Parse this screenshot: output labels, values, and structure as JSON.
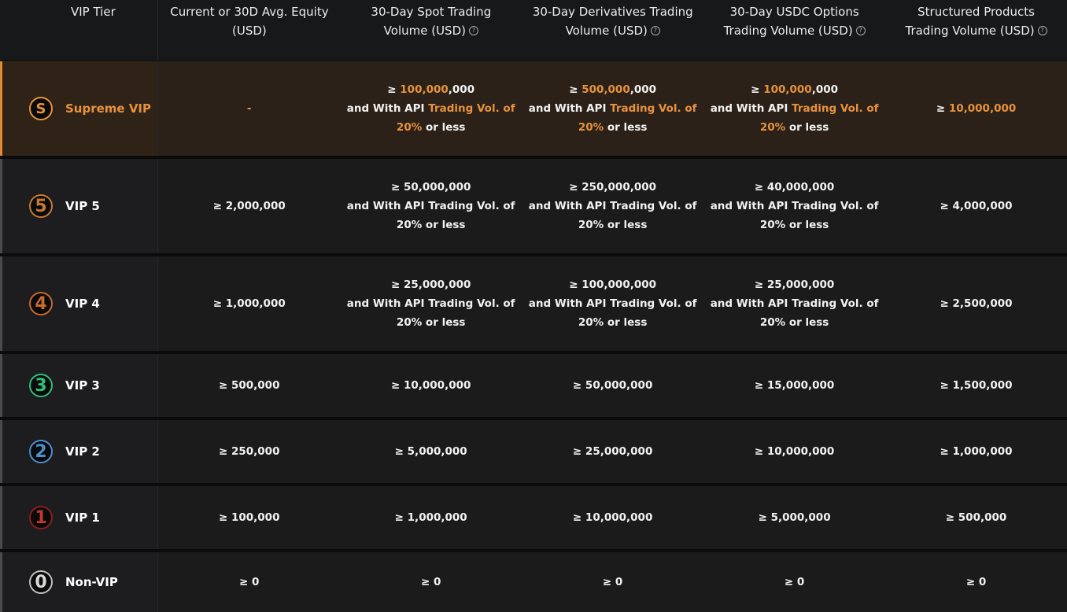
{
  "header": {
    "tier": "VIP Tier",
    "equity": [
      "Current or 30D Avg. Equity",
      "(USD)"
    ],
    "spot": [
      "30-Day Spot Trading",
      "Volume (USD)"
    ],
    "derivatives": [
      "30-Day Derivatives Trading",
      "Volume (USD)"
    ],
    "options": [
      "30-Day USDC Options",
      "Trading Volume (USD)"
    ],
    "structured": [
      "Structured Products",
      "Trading Volume (USD)"
    ],
    "help_icon": "question-circle-icon"
  },
  "supreme": {
    "badge": "S",
    "name_prefix": "Supreme",
    "name_suffix": " VIP",
    "equity": "-",
    "spot_ge": "≥ ",
    "spot_highlight": "100,000",
    "spot_rest": ",000",
    "deriv_ge": "≥ ",
    "deriv_highlight": "500,000",
    "deriv_rest": ",000",
    "options_ge": "≥ ",
    "options_highlight": "100,000",
    "options_rest": ",000",
    "api_prefix": "and With API ",
    "api_highlight": "Trading Vol. of",
    "api_pct": "20%",
    "api_suffix": " or less",
    "structured_ge": "≥ ",
    "structured_highlight": "10,000,000"
  },
  "api_line1": "and With API Trading Vol. of",
  "api_line2": "20% or less",
  "tiers": [
    {
      "badge": "5",
      "name": "VIP 5",
      "equity": "≥ 2,000,000",
      "spot": "≥ 50,000,000",
      "deriv": "≥ 250,000,000",
      "options": "≥ 40,000,000",
      "structured": "≥ 4,000,000"
    },
    {
      "badge": "4",
      "name": "VIP 4",
      "equity": "≥ 1,000,000",
      "spot": "≥ 25,000,000",
      "deriv": "≥ 100,000,000",
      "options": "≥ 25,000,000",
      "structured": "≥ 2,500,000"
    },
    {
      "badge": "3",
      "name": "VIP 3",
      "equity": "≥ 500,000",
      "spot": "≥ 10,000,000",
      "deriv": "≥ 50,000,000",
      "options": "≥ 15,000,000",
      "structured": "≥ 1,500,000"
    },
    {
      "badge": "2",
      "name": "VIP 2",
      "equity": "≥ 250,000",
      "spot": "≥ 5,000,000",
      "deriv": "≥ 25,000,000",
      "options": "≥ 10,000,000",
      "structured": "≥ 1,000,000"
    },
    {
      "badge": "1",
      "name": "VIP 1",
      "equity": "≥ 100,000",
      "spot": "≥ 1,000,000",
      "deriv": "≥ 10,000,000",
      "options": "≥ 5,000,000",
      "structured": "≥ 500,000"
    },
    {
      "badge": "0",
      "name": "Non-VIP",
      "equity": "≥ 0",
      "spot": "≥ 0",
      "deriv": "≥ 0",
      "options": "≥ 0",
      "structured": "≥ 0"
    }
  ],
  "colors": {
    "accent": "#e8923e",
    "badge_s": "#e8923e",
    "badge_5": "#c77a35",
    "badge_4": "#c56a2a",
    "badge_3": "#2fbf7a",
    "badge_2": "#4a8fd0",
    "badge_1": "#c0392b",
    "badge_0": "#d8d8d8"
  }
}
